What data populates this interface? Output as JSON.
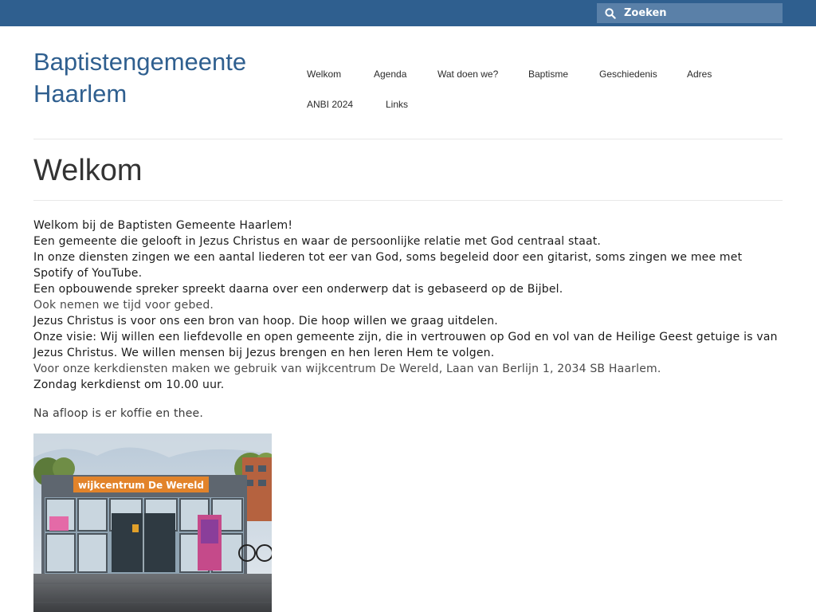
{
  "search": {
    "placeholder": "Zoeken"
  },
  "site": {
    "title_line1": "Baptistengemeente",
    "title_line2": "Haarlem"
  },
  "nav": {
    "items": [
      "Welkom",
      "Agenda",
      "Wat doen we?",
      "Baptisme",
      "Geschiedenis",
      "Adres",
      "ANBI 2024",
      "Links"
    ]
  },
  "page": {
    "title": "Welkom"
  },
  "content": {
    "lines": [
      "Welkom bij de Baptisten Gemeente Haarlem!",
      "Een gemeente die gelooft in Jezus Christus en waar de persoonlijke relatie met God centraal staat.",
      "In onze diensten zingen we een aantal liederen tot eer van God, soms begeleid door een gitarist, soms zingen we mee met Spotify of YouTube.",
      "Een opbouwende spreker spreekt daarna over een onderwerp dat is gebaseerd op de Bijbel.",
      "Ook nemen we tijd voor gebed.",
      "Jezus Christus is voor ons een bron van hoop. Die hoop willen we graag uitdelen.",
      "Onze visie: Wij willen een liefdevolle en open gemeente zijn, die in vertrouwen op God en vol van de Heilige Geest getuige is van Jezus Christus. We willen mensen bij Jezus brengen en hen leren Hem te volgen.",
      "Voor onze kerkdiensten maken we gebruik van wijkcentrum De Wereld, Laan van Berlijn 1, 2034 SB Haarlem.",
      "Zondag kerkdienst om 10.00 uur."
    ],
    "after": "Na afloop is er koffie en thee."
  },
  "photo": {
    "sign_text": "wijkcentrum De Wereld"
  },
  "colors": {
    "topbar": "#2f5f8f",
    "search_bg": "#5a80a8",
    "title_blue": "#2f5f8f"
  }
}
